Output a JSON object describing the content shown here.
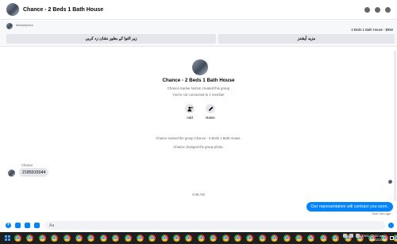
{
  "header": {
    "title": "Chance - 2 Beds 1 Bath House"
  },
  "marketplace": {
    "label": "Marketplace",
    "listing": "2 Beds 1 Bath House - $950",
    "buttons": {
      "left": "زیر التوا کے بطور نشان زد کریں",
      "right": "مزید آپشنز"
    }
  },
  "conversation": {
    "group_name": "Chance - 2 Beds 1 Bath House",
    "created_by": "Chance Karlee Norton created this group",
    "connected": "You're not connected to 1 member",
    "actions": {
      "add": "Add",
      "name": "Name"
    },
    "events": [
      "Chance named the group Chance - 2 Beds 1 Bath House.",
      "Chance changed the group photo."
    ],
    "sender_name": "Chance",
    "incoming_message": "2185915044",
    "timestamp": "6:46 AM",
    "outgoing_message": "Our representative will contract you soon.",
    "sent_status": "Sent 16m ago"
  },
  "composer": {
    "placeholder": "Aa"
  },
  "taskbar": {
    "app_count": 40,
    "tray_lang": "ENG",
    "time": "7:02 am",
    "date": "03/02/2025"
  },
  "colors": {
    "accent": "#0084ff",
    "bubble_in": "#e4e6eb",
    "taskbar": "#1f1f1f"
  }
}
